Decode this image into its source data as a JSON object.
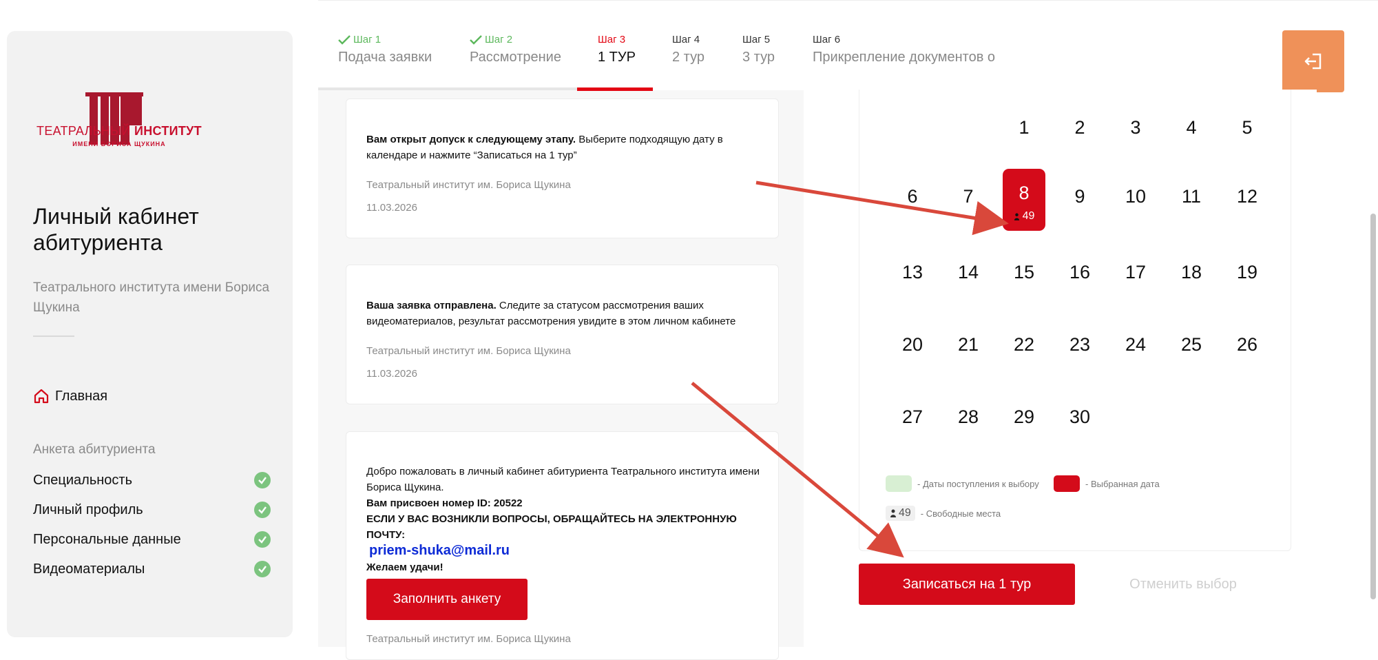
{
  "brand": {
    "title_regular": "ТЕАТРАЛЬНЫЙ",
    "title_bold": "ИНСТИТУТ",
    "subtitle": "ИМЕНИ БОРИСА ЩУКИНА"
  },
  "sidebar": {
    "cabinet_title": "Личный кабинет абитуриента",
    "cabinet_subtitle": "Театрального института имени Бориса Щукина",
    "home_label": "Главная",
    "section_label": "Анкета абитуриента",
    "items": [
      {
        "label": "Специальность",
        "status": "done"
      },
      {
        "label": "Личный профиль",
        "status": "done"
      },
      {
        "label": "Персональные данные",
        "status": "done"
      },
      {
        "label": "Видеоматериалы",
        "status": "done"
      }
    ]
  },
  "steps": [
    {
      "label": "Шаг 1",
      "name": "Подача заявки",
      "state": "done"
    },
    {
      "label": "Шаг 2",
      "name": "Рассмотрение",
      "state": "done"
    },
    {
      "label": "Шаг 3",
      "name": "1 ТУР",
      "state": "active"
    },
    {
      "label": "Шаг 4",
      "name": "2 тур",
      "state": "pending"
    },
    {
      "label": "Шаг 5",
      "name": "3 тур",
      "state": "pending"
    },
    {
      "label": "Шаг 6",
      "name": "Прикрепление документов о",
      "state": "pending"
    }
  ],
  "feed": [
    {
      "bold": "Вам открыт допуск к следующему этапу.",
      "text": " Выберите подходящую дату в календаре и нажмите “Записаться на 1 тур”",
      "source": "Театральный институт им. Бориса Щукина",
      "date": "11.03.2026"
    },
    {
      "bold": "Ваша заявка отправлена.",
      "text": " Следите за статусом рассмотрения ваших видеоматериалов, результат рассмотрения увидите в этом личном кабинете",
      "source": "Театральный институт им. Бориса Щукина",
      "date": "11.03.2026"
    },
    {
      "welcome": "Добро пожаловать в личный кабинет абитуриента Театрального института имени Бориса Щукина.",
      "id_line": "Вам присвоен номер ID: 20522",
      "questions": "ЕСЛИ У ВАС ВОЗНИКЛИ ВОПРОСЫ, ОБРАЩАЙТЕСЬ НА ЭЛЕКТРОННУЮ ПОЧТУ:",
      "email": "priem-shuka@mail.ru",
      "wish": "Желаем удачи!",
      "button": "Заполнить анкету",
      "source": "Театральный институт им. Бориса Щукина"
    }
  ],
  "calendar": {
    "days": [
      "1",
      "2",
      "3",
      "4",
      "5",
      "6",
      "7",
      "8",
      "9",
      "10",
      "11",
      "12",
      "13",
      "14",
      "15",
      "16",
      "17",
      "18",
      "19",
      "20",
      "21",
      "22",
      "23",
      "24",
      "25",
      "26",
      "27",
      "28",
      "29",
      "30"
    ],
    "selected_day": "8",
    "selected_seats": "49",
    "legend": {
      "available": "- Даты поступления к выбору",
      "selected": "- Выбранная дата",
      "seats_value": "49",
      "seats": "- Свободные места"
    },
    "colors": {
      "available": "#d8efd3",
      "selected": "#d40b1a"
    }
  },
  "actions": {
    "signup": "Записаться на 1 тур",
    "cancel": "Отменить выбор"
  },
  "colors": {
    "accent": "#d40b1a",
    "exit": "#ef9159",
    "done": "#5cb85c"
  }
}
